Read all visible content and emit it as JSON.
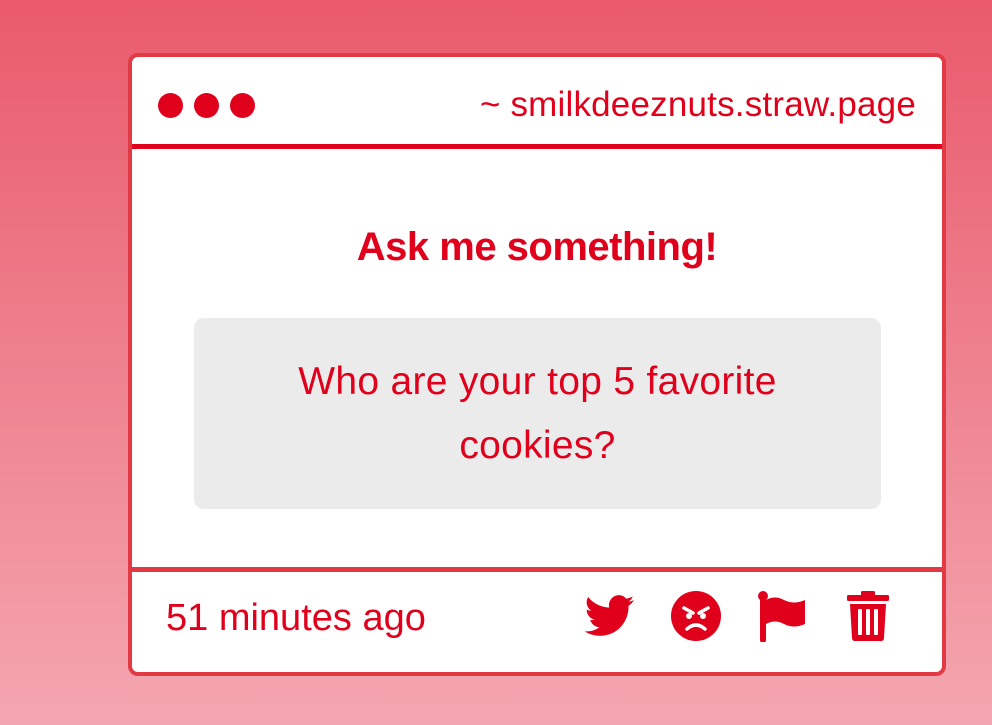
{
  "window": {
    "url": "~ smilkdeeznuts.straw.page"
  },
  "main": {
    "heading": "Ask me something!",
    "question": "Who are your top 5 favorite cookies?"
  },
  "footer": {
    "timestamp": "51 minutes ago",
    "actions": [
      "twitter-icon",
      "angry-face-icon",
      "flag-icon",
      "trash-icon"
    ]
  },
  "colors": {
    "accent": "#e0001b",
    "border": "#e23a45",
    "question_bg": "#ecebec",
    "background_top": "#e95a6c",
    "background_bottom": "#f4a6b0"
  }
}
